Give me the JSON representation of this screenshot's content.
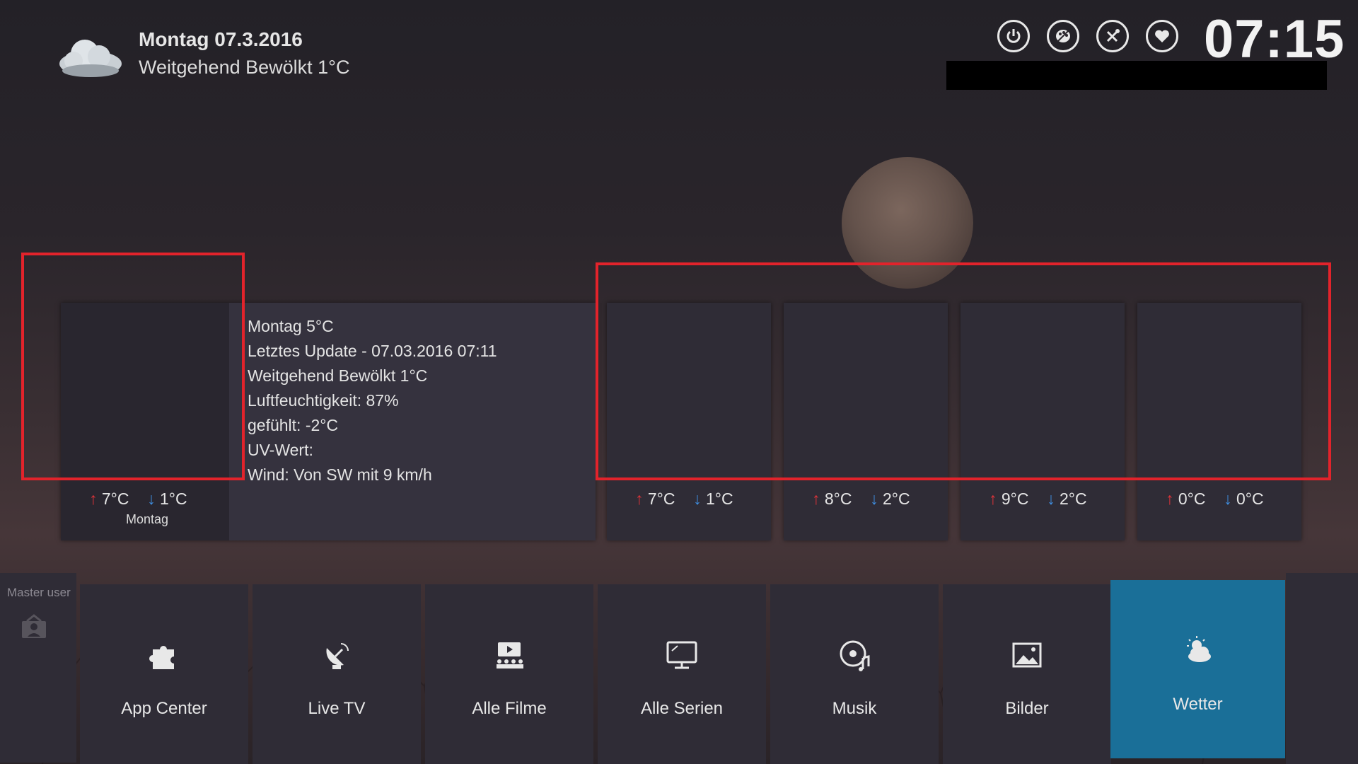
{
  "header": {
    "date": "Montag  07.3.2016",
    "condition": "Weitgehend Bewölkt  1°C",
    "clock": "07:15"
  },
  "top_icons": [
    "power-icon",
    "palette-icon",
    "tools-icon",
    "favourites-icon"
  ],
  "current": {
    "details": [
      "Montag  5°C",
      "Letztes Update - 07.03.2016 07:11",
      "Weitgehend Bewölkt  1°C",
      "Luftfeuchtigkeit: 87%",
      "gefühlt: -2°C",
      "UV-Wert:",
      "Wind: Von SW mit 9 km/h"
    ],
    "high": "7°C",
    "low": "1°C",
    "day": "Montag"
  },
  "forecast": [
    {
      "high": "7°C",
      "low": "1°C"
    },
    {
      "high": "8°C",
      "low": "2°C"
    },
    {
      "high": "9°C",
      "low": "2°C"
    },
    {
      "high": "0°C",
      "low": "0°C"
    }
  ],
  "user": {
    "label": "Master user"
  },
  "menu": [
    {
      "label": "App Center",
      "icon": "puzzle-icon"
    },
    {
      "label": "Live TV",
      "icon": "satellite-dish-icon"
    },
    {
      "label": "Alle Filme",
      "icon": "movie-theater-icon"
    },
    {
      "label": "Alle Serien",
      "icon": "tv-monitor-icon"
    },
    {
      "label": "Musik",
      "icon": "music-disc-icon"
    },
    {
      "label": "Bilder",
      "icon": "picture-icon"
    },
    {
      "label": "Wetter",
      "icon": "weather-icon",
      "active": true
    }
  ],
  "colors": {
    "accent": "#1a6f98",
    "highlight_box": "#e2232b",
    "temp_up": "#e0343a",
    "temp_down": "#3f8ee0"
  }
}
